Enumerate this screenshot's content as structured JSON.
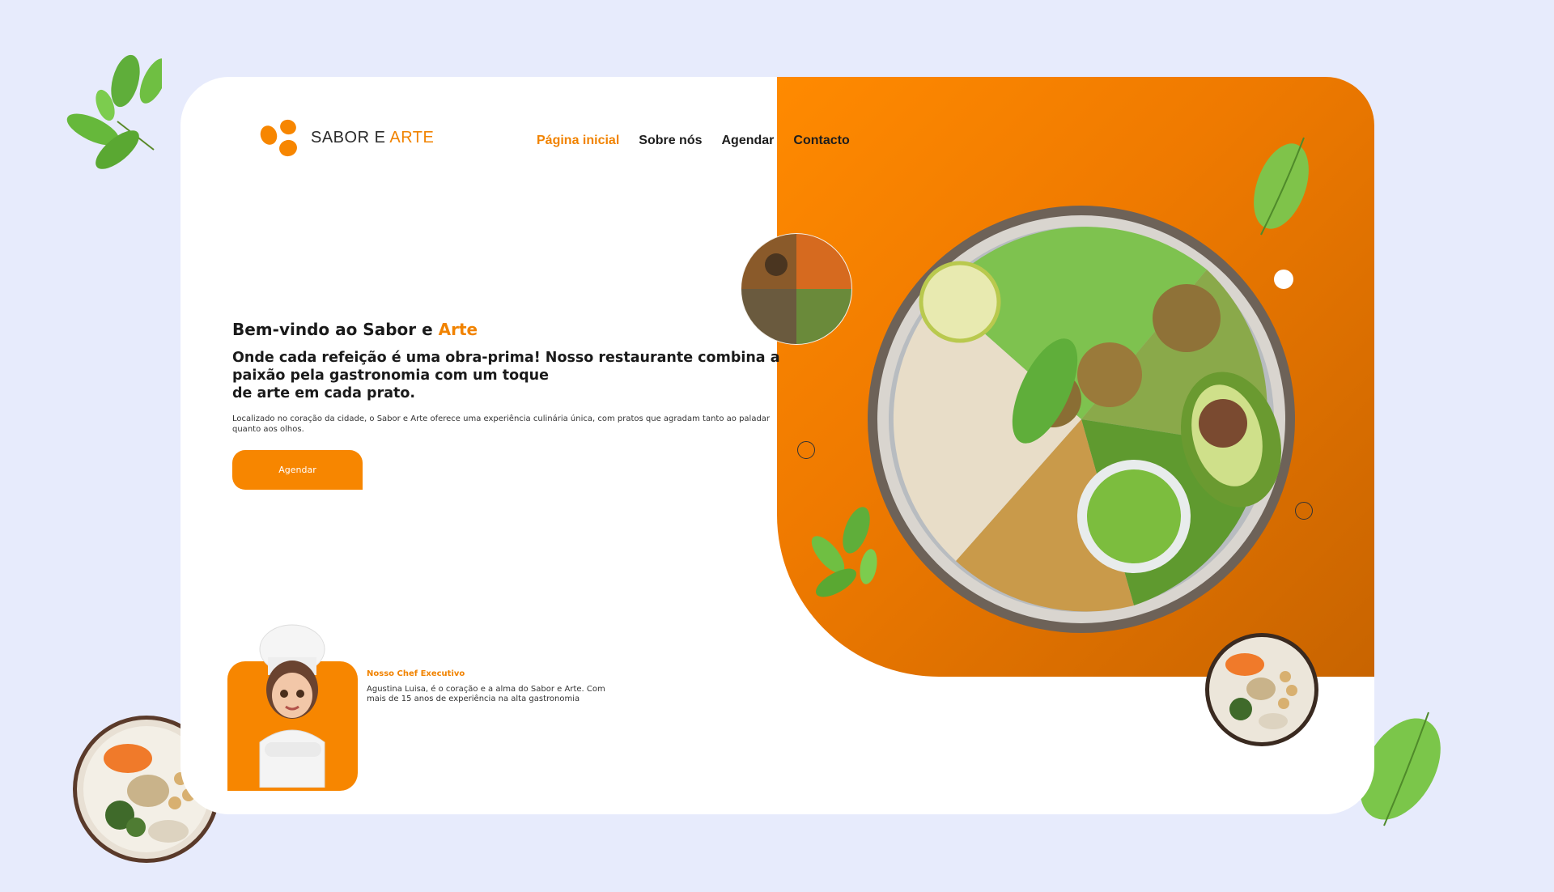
{
  "brand": {
    "name_part1": "SABOR E ",
    "name_part2": "ARTE"
  },
  "nav": {
    "items": [
      {
        "label": "Página inicial",
        "active": true
      },
      {
        "label": "Sobre nós",
        "active": false
      },
      {
        "label": "Agendar",
        "active": false
      },
      {
        "label": "Contacto",
        "active": false
      }
    ]
  },
  "hero": {
    "title_part1": "Bem-vindo ao Sabor e ",
    "title_part2": "Arte",
    "subtitle_line1": "Onde cada refeição é uma obra-prima! Nosso restaurante combina a",
    "subtitle_line2": "paixão pela gastronomia com um toque",
    "subtitle_line3": "de arte em cada prato.",
    "description": "Localizado no coração da cidade, o Sabor e Arte oferece uma experiência culinária única, com pratos que agradam tanto ao paladar quanto aos olhos.",
    "button_label": "Agendar"
  },
  "chef": {
    "title": "Nosso Chef Executivo",
    "description": "Agustina Luisa, é o coração e a alma do Sabor e Arte. Com mais de 15 anos de experiência na alta gastronomia"
  },
  "colors": {
    "accent": "#f78600",
    "background": "#e7ebfc",
    "card": "#ffffff"
  },
  "icons": [
    "logo-icon",
    "leaf-icon",
    "food-bowl-image",
    "chef-avatar"
  ]
}
